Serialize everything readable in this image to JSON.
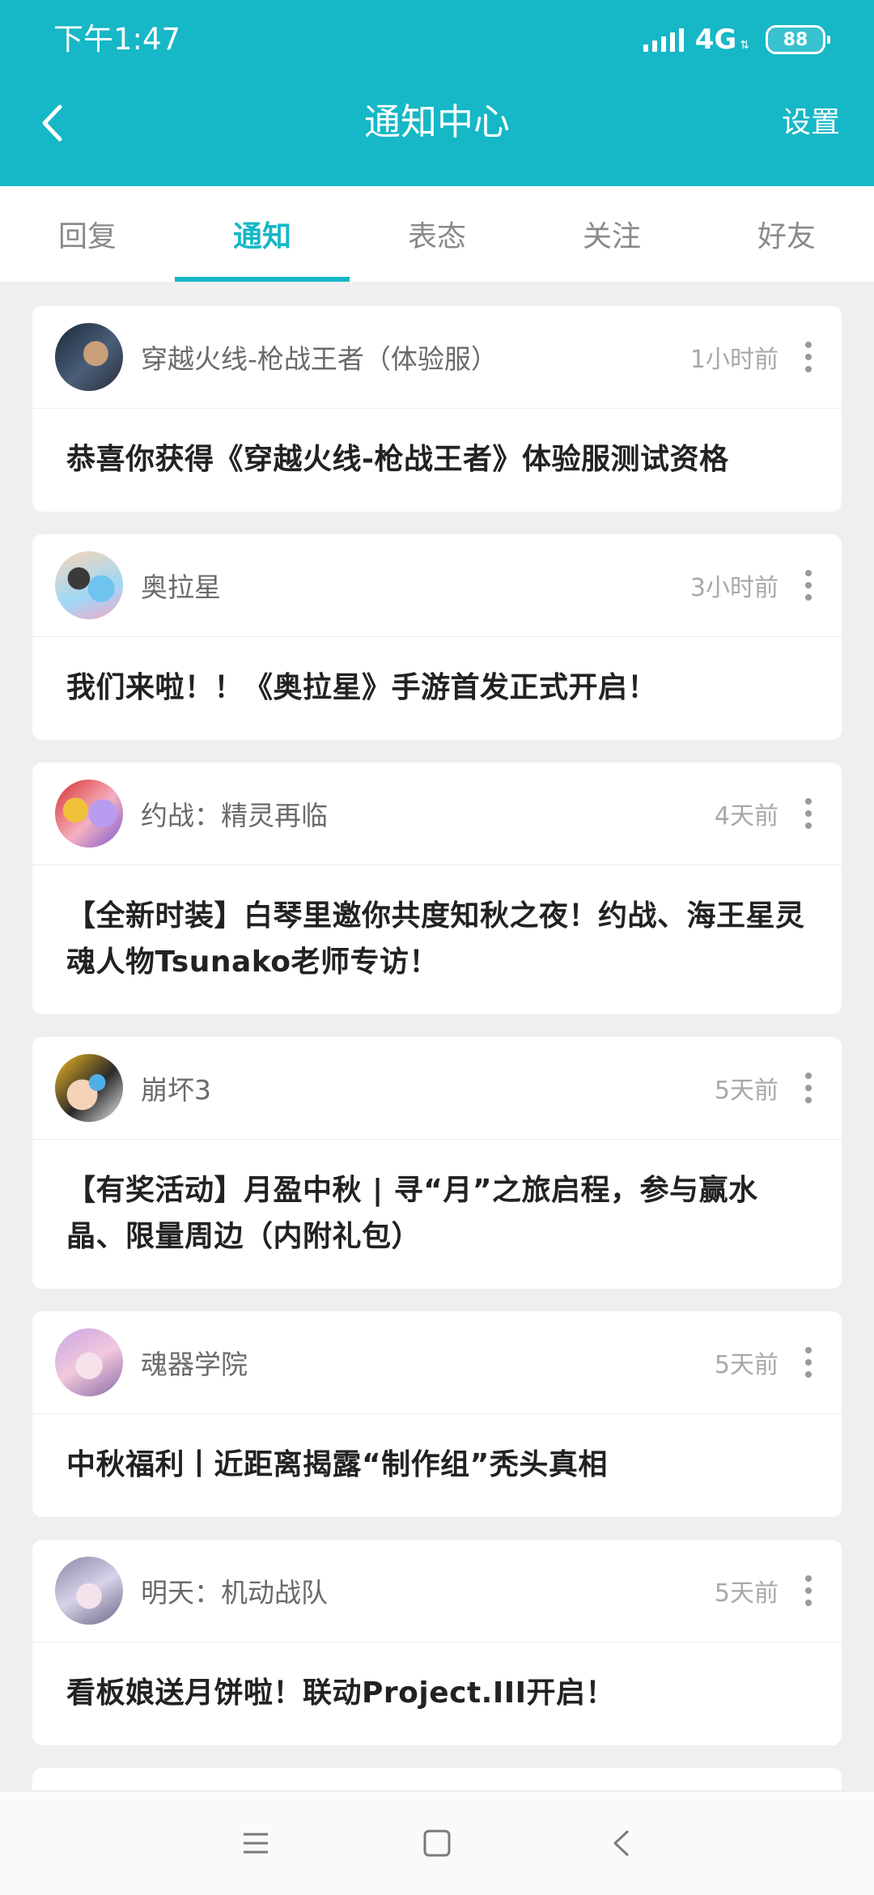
{
  "status_bar": {
    "time": "下午1:47",
    "network": "4G",
    "battery": "88"
  },
  "header": {
    "title": "通知中心",
    "settings_label": "设置"
  },
  "tabs": [
    {
      "label": "回复"
    },
    {
      "label": "通知",
      "active": true
    },
    {
      "label": "表态"
    },
    {
      "label": "关注"
    },
    {
      "label": "好友"
    }
  ],
  "notifications": [
    {
      "source": "穿越火线-枪战王者（体验服）",
      "time": "1小时前",
      "text": "恭喜你获得《穿越火线-枪战王者》体验服测试资格"
    },
    {
      "source": "奥拉星",
      "time": "3小时前",
      "text": "我们来啦！！《奥拉星》手游首发正式开启！"
    },
    {
      "source": "约战：精灵再临",
      "time": "4天前",
      "text": "【全新时装】白琴里邀你共度知秋之夜！约战、海王星灵魂人物Tsunako老师专访！"
    },
    {
      "source": "崩坏3",
      "time": "5天前",
      "text": "【有奖活动】月盈中秋 | 寻“月”之旅启程，参与赢水晶、限量周边（内附礼包）"
    },
    {
      "source": "魂器学院",
      "time": "5天前",
      "text": "中秋福利丨近距离揭露“制作组”秃头真相"
    },
    {
      "source": "明天：机动战队",
      "time": "5天前",
      "text": "看板娘送月饼啦！联动Project.III开启！"
    }
  ],
  "colors": {
    "accent": "#16b7c6",
    "background": "#efefef",
    "card": "#ffffff"
  },
  "icons": {
    "back": "chevron-left-icon",
    "more": "more-vertical-icon",
    "nav_menu": "menu-icon",
    "nav_home": "square-icon",
    "nav_back": "back-triangle-icon"
  }
}
